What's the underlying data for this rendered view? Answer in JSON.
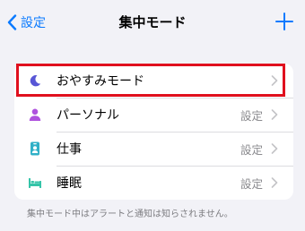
{
  "nav": {
    "back_label": "設定",
    "title": "集中モード"
  },
  "focus_modes": [
    {
      "label": "おやすみモード",
      "detail": "",
      "icon": "moon-icon",
      "color": "#5856d6"
    },
    {
      "label": "パーソナル",
      "detail": "設定",
      "icon": "person-icon",
      "color": "#af52de"
    },
    {
      "label": "仕事",
      "detail": "設定",
      "icon": "work-badge-icon",
      "color": "#30b0c7"
    },
    {
      "label": "睡眠",
      "detail": "設定",
      "icon": "bed-icon",
      "color": "#34c4a8"
    }
  ],
  "footer_text": "集中モード中はアラートと通知は知らされません。",
  "colors": {
    "accent": "#0a7aff",
    "background": "#f2f2f7",
    "highlight": "#e0101e"
  }
}
